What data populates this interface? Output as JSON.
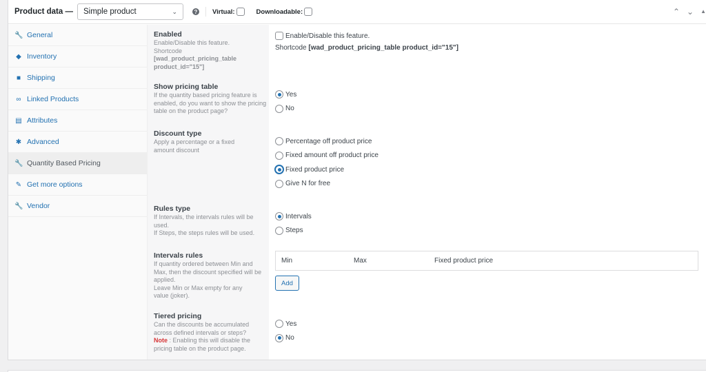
{
  "header": {
    "title": "Product data —",
    "product_type": "Simple product",
    "help_icon": "question-circle-icon",
    "virtual_label": "Virtual:",
    "virtual_checked": false,
    "downloadable_label": "Downloadable:",
    "downloadable_checked": false,
    "actions": {
      "move_up": "^",
      "move_down": "v",
      "toggle": "▲"
    }
  },
  "tabs": [
    {
      "label": "General",
      "icon": "wrench-icon",
      "glyph": "🔧",
      "active": false
    },
    {
      "label": "Inventory",
      "icon": "tag-icon",
      "glyph": "◆",
      "active": false
    },
    {
      "label": "Shipping",
      "icon": "truck-icon",
      "glyph": "■",
      "active": false
    },
    {
      "label": "Linked Products",
      "icon": "link-icon",
      "glyph": "∞",
      "active": false
    },
    {
      "label": "Attributes",
      "icon": "list-icon",
      "glyph": "▤",
      "active": false
    },
    {
      "label": "Advanced",
      "icon": "gear-icon",
      "glyph": "✱",
      "active": false
    },
    {
      "label": "Quantity Based Pricing",
      "icon": "wrench-icon",
      "glyph": "🔧",
      "active": true
    },
    {
      "label": "Get more options",
      "icon": "plugin-icon",
      "glyph": "✎",
      "active": false
    },
    {
      "label": "Vendor",
      "icon": "wrench-icon",
      "glyph": "🔧",
      "active": false
    }
  ],
  "fields": {
    "enabled": {
      "title": "Enabled",
      "desc1": "Enable/Disable this feature.",
      "desc2": "Shortcode",
      "desc_code": "[wad_product_pricing_table product_id=\"15\"]",
      "checkbox_label": "Enable/Disable this feature.",
      "checked": false,
      "shortcode_label": "Shortcode",
      "shortcode_value": "[wad_product_pricing_table product_id=\"15\"]"
    },
    "show_pricing_table": {
      "title": "Show pricing table",
      "desc": "If the quantity based pricing feature is enabled, do you want to show the pricing table on the product page?",
      "options": [
        "Yes",
        "No"
      ],
      "selected": "Yes"
    },
    "discount_type": {
      "title": "Discount type",
      "desc": "Apply a percentage or a fixed amount discount",
      "options": [
        "Percentage off product price",
        "Fixed amount off product price",
        "Fixed product price",
        "Give N for free"
      ],
      "selected": "Fixed product price"
    },
    "rules_type": {
      "title": "Rules type",
      "desc1": "If Intervals, the intervals rules will be used.",
      "desc2": "If Steps, the steps rules will be used.",
      "options": [
        "Intervals",
        "Steps"
      ],
      "selected": "Intervals"
    },
    "intervals_rules": {
      "title": "Intervals rules",
      "desc1": "If quantity ordered between Min and Max, then the discount specified will be applied.",
      "desc2": "Leave Min or Max empty for any value (joker).",
      "columns": [
        "Min",
        "Max",
        "Fixed product price"
      ],
      "add_label": "Add"
    },
    "tiered_pricing": {
      "title": "Tiered pricing",
      "desc": "Can the discounts be accumulated across defined intervals or steps?",
      "note_label": "Note",
      "note_text": " : Enabling this will disable the pricing table on the product page.",
      "options": [
        "Yes",
        "No"
      ],
      "selected": "No"
    }
  }
}
